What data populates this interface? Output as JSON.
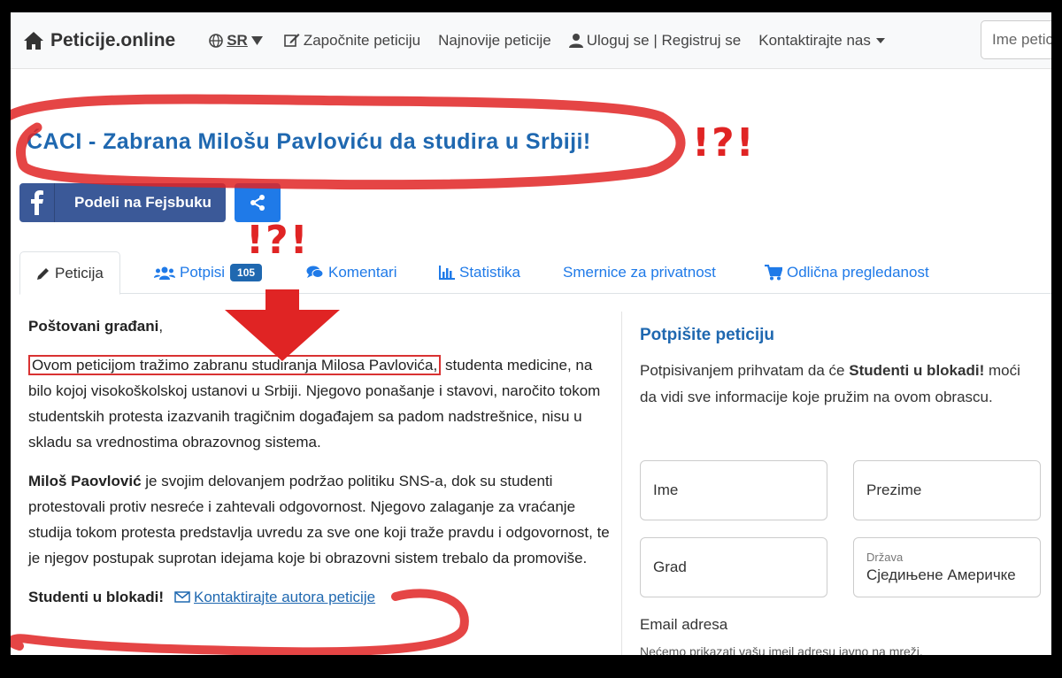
{
  "navbar": {
    "brand": "Peticije.online",
    "lang": "SR",
    "start": "Započnite peticiju",
    "latest": "Najnovije peticije",
    "login": "Uloguj se | Registruj se",
    "contact": "Kontaktirajte nas",
    "search_placeholder": "Ime petic"
  },
  "annotations": {
    "exclaim": "!?!"
  },
  "petition": {
    "title": "ĆACI - Zabrana Milošu Pavloviću da studira u Srbiji!",
    "share_fb": "Podeli na Fejsbuku"
  },
  "tabs": [
    {
      "label": "Peticija"
    },
    {
      "label": "Potpisi",
      "badge": "105"
    },
    {
      "label": "Komentari"
    },
    {
      "label": "Statistika"
    },
    {
      "label": "Smernice za privatnost"
    },
    {
      "label": "Odlična pregledanost"
    }
  ],
  "body": {
    "greeting": "Poštovani građani",
    "greeting_comma": ",",
    "p1_boxed": "Ovom peticijom tražimo zabranu studiranja Milosa Pavlovića,",
    "p1_rest": " studenta medicine, na bilo kojoj visokoškolskoj ustanovi u Srbiji. Njegovo ponašanje i stavovi, naročito tokom studentskih protesta izazvanih tragičnim događajem sa padom nadstrešnice, nisu u skladu sa vrednostima obrazovnog sistema.",
    "p2_bold": "Miloš Paovlović",
    "p2_rest": " je svojim delovanjem podržao politiku SNS-a, dok su studenti protestovali protiv nesreće i zahtevali odgovornost. Njegovo zalaganje za vraćanje studija tokom protesta predstavlja uvredu za sve one koji traže pravdu i odgovornost, te je njegov postupak suprotan idejama koje bi obrazovni sistem trebalo da promoviše.",
    "author": "Studenti u blokadi!",
    "contact_author": "Kontaktirajte autora peticije"
  },
  "form": {
    "title": "Potpišite peticiju",
    "intro_pre": "Potpisivanjem prihvatam da će ",
    "intro_bold": "Studenti u blokadi!",
    "intro_post": " moći da vidi sve informacije koje pružim na ovom obrascu.",
    "first_name": "Ime",
    "last_name": "Prezime",
    "city": "Grad",
    "country_label": "Država",
    "country_value": "Сједињене Америчке",
    "email_label": "Email adresa",
    "email_help": "Nećemo prikazati vašu imejl adresu javno na mreži."
  },
  "colors": {
    "link": "#1f68b0",
    "facebook": "#3b5998",
    "share": "#1f7ae8",
    "annotation_red": "#e02424"
  }
}
